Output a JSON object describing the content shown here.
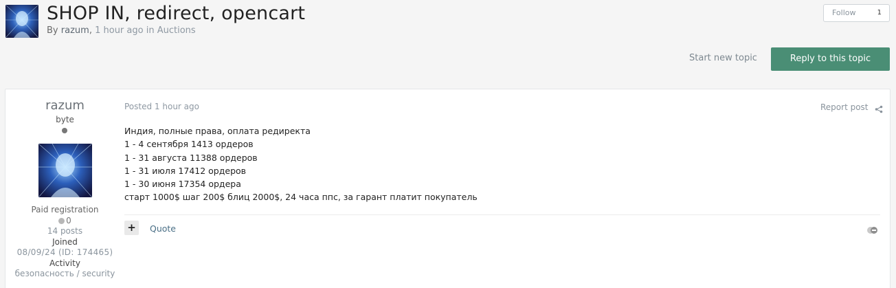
{
  "topic": {
    "title": "SHOP IN, redirect, opencart",
    "by_prefix": "By",
    "author": "razum",
    "time": "1 hour ago",
    "in_word": "in",
    "forum": "Auctions"
  },
  "actions": {
    "follow_label": "Follow",
    "follow_count": "1",
    "start_topic_label": "Start new topic",
    "reply_label": "Reply to this topic"
  },
  "post": {
    "author": {
      "name": "razum",
      "group": "byte",
      "badge": "Paid registration",
      "reputation": "0",
      "posts": "14 posts",
      "joined_label": "Joined",
      "joined_value": "08/09/24 (ID: 174465)",
      "activity_label": "Activity",
      "activity_value": "безопасность / security"
    },
    "posted": "Posted 1 hour ago",
    "report_label": "Report post",
    "content_lines": [
      "Индия, полные права, оплата редиректа",
      "1 - 4 сентября 1413 ордеров",
      "1 - 31 августа 11388 ордеров",
      "1 - 31 июля 17412 ордеров",
      "1 - 30 июня 17354 ордера",
      "старт 1000$ шаг 200$ блиц 2000$, 24 часа ппс, за гарант платит покупатель"
    ],
    "plus_label": "+",
    "quote_label": "Quote"
  },
  "icons": {
    "share": "share-icon",
    "reactions": "reaction-icon",
    "status": "offline-status-icon"
  },
  "colors": {
    "accent": "#4a8e75",
    "background": "#f5f5f5",
    "link": "#4a6f86"
  }
}
